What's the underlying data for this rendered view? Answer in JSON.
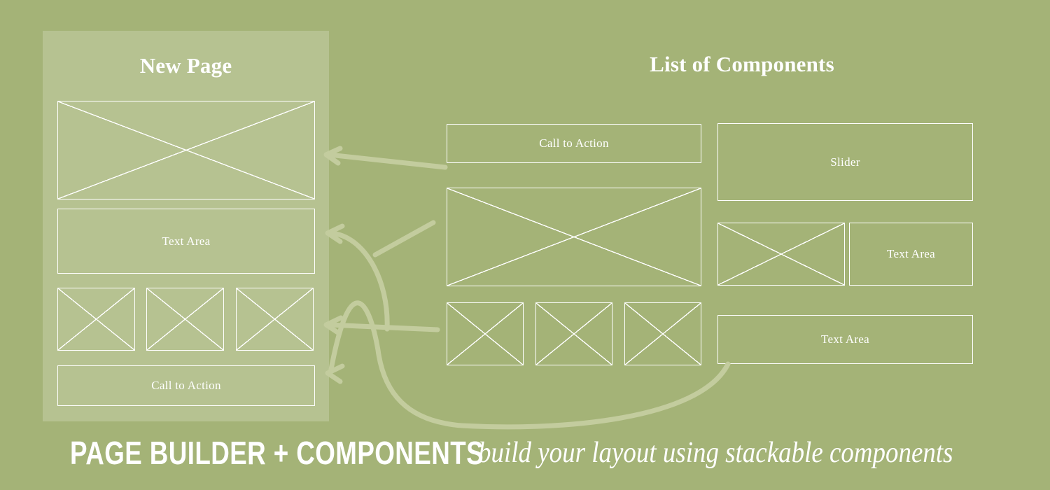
{
  "colors": {
    "background": "#a4b377",
    "panel_overlay": "#b6c291",
    "outline": "#ffffff",
    "arrow": "#c3cc9e",
    "text": "#ffffff"
  },
  "left_panel": {
    "title": "New Page",
    "components": [
      {
        "id": "hero-image",
        "type": "image",
        "label": ""
      },
      {
        "id": "text-area",
        "type": "text-area",
        "label": "Text Area"
      },
      {
        "id": "image-1",
        "type": "image",
        "label": ""
      },
      {
        "id": "image-2",
        "type": "image",
        "label": ""
      },
      {
        "id": "image-3",
        "type": "image",
        "label": ""
      },
      {
        "id": "call-to-action",
        "type": "call-to-action",
        "label": "Call to Action"
      }
    ]
  },
  "right_panel": {
    "title": "List of Components",
    "components": [
      {
        "id": "cta",
        "type": "call-to-action",
        "label": "Call to Action"
      },
      {
        "id": "slider",
        "type": "slider",
        "label": "Slider"
      },
      {
        "id": "big-image",
        "type": "image",
        "label": ""
      },
      {
        "id": "small-image",
        "type": "image",
        "label": ""
      },
      {
        "id": "text-area-side",
        "type": "text-area",
        "label": "Text Area"
      },
      {
        "id": "thumb-1",
        "type": "image",
        "label": ""
      },
      {
        "id": "thumb-2",
        "type": "image",
        "label": ""
      },
      {
        "id": "thumb-3",
        "type": "image",
        "label": ""
      },
      {
        "id": "text-area-wide",
        "type": "text-area",
        "label": "Text Area"
      }
    ]
  },
  "caption": {
    "strong": "PAGE BUILDER + COMPONENTS",
    "emphasis": "build your layout using stackable components"
  },
  "arrows": {
    "count": 4,
    "description": "hand-drawn arrows pointing from the component list to slots in the new page"
  }
}
